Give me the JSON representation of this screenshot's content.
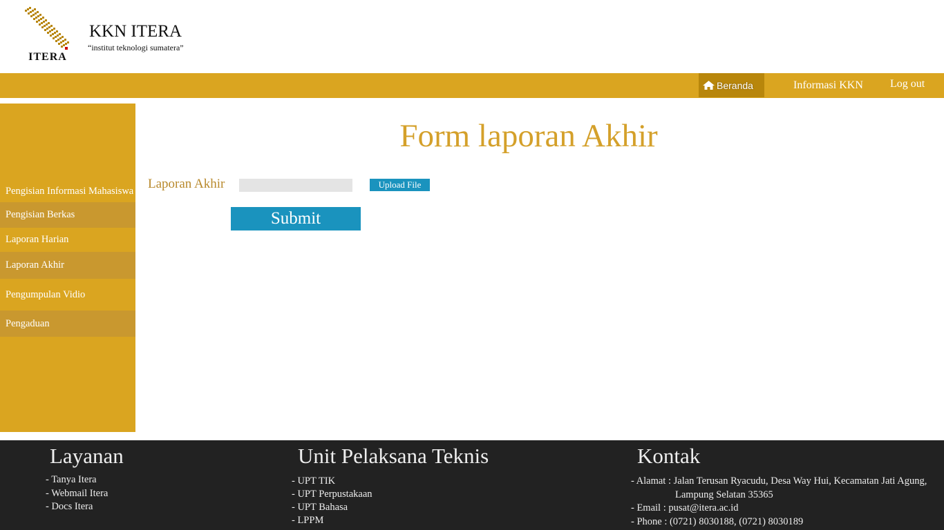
{
  "header": {
    "logo_text": "ITERA",
    "title": "KKN ITERA",
    "subtitle": "“institut teknologi sumatera”"
  },
  "topnav": {
    "home_label": "Beranda",
    "home_icon": "home-icon",
    "info_label": "Informasi KKN",
    "logout_label": "Log out"
  },
  "sidebar": {
    "items": [
      {
        "label": "Pengisian Informasi Mahasiswa"
      },
      {
        "label": "Pengisian Berkas"
      },
      {
        "label": "Laporan Harian"
      },
      {
        "label": "Laporan Akhir"
      },
      {
        "label": "Pengumpulan Vidio"
      },
      {
        "label": "Pengaduan"
      }
    ]
  },
  "main": {
    "title": "Form laporan Akhir",
    "field_label": "Laporan Akhir",
    "file_value": "",
    "upload_label": "Upload File",
    "submit_label": "Submit"
  },
  "footer": {
    "layanan": {
      "heading": "Layanan",
      "items": [
        "- Tanya Itera",
        "- Webmail Itera",
        "- Docs Itera"
      ]
    },
    "upt": {
      "heading": "Unit Pelaksana Teknis",
      "items": [
        "- UPT TIK",
        "- UPT Perpustakaan",
        "- UPT Bahasa",
        "- LPPM"
      ]
    },
    "kontak": {
      "heading": "Kontak",
      "address_line1": "- Alamat : Jalan Terusan Ryacudu, Desa Way Hui, Kecamatan Jati Agung,",
      "address_line2": "Lampung Selatan 35365",
      "email": "- Email : pusat@itera.ac.id",
      "phone": "- Phone : (0721) 8030188, (0721) 8030189"
    }
  },
  "colors": {
    "accent": "#DAA520",
    "accent_dark": "#B8860B",
    "button": "#1A93BE",
    "footer_bg": "#222222",
    "title": "#D4A02A"
  }
}
